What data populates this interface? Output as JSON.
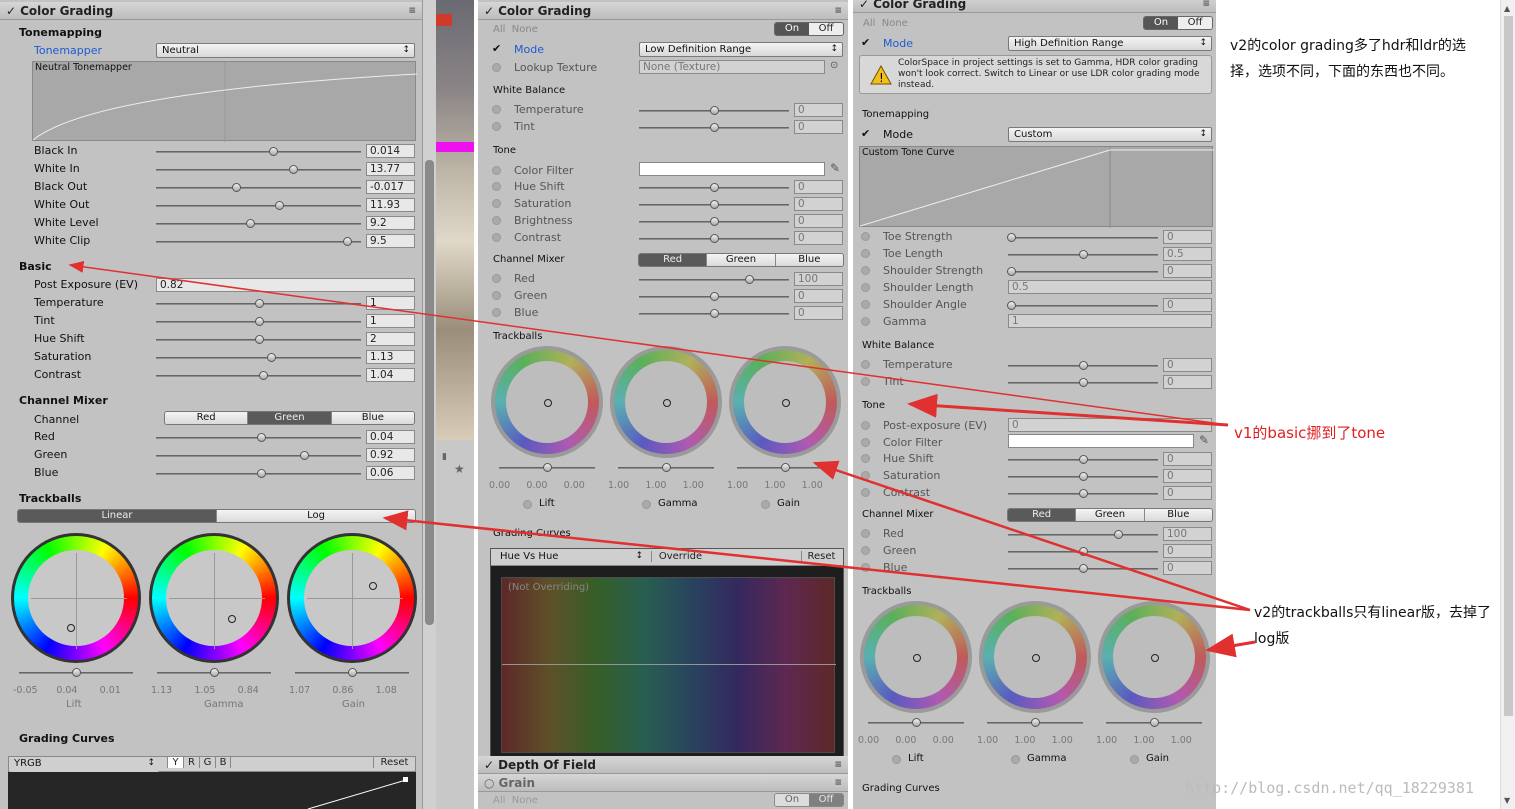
{
  "v1": {
    "header": "Color Grading",
    "tonemapping": "Tonemapping",
    "tonemapper_label": "Tonemapper",
    "tonemapper_value": "Neutral",
    "curve_label": "Neutral Tonemapper",
    "tone_rows": [
      {
        "l": "Black In",
        "v": "0.014"
      },
      {
        "l": "White In",
        "v": "13.77"
      },
      {
        "l": "Black Out",
        "v": "-0.017"
      },
      {
        "l": "White Out",
        "v": "11.93"
      },
      {
        "l": "White Level",
        "v": "9.2"
      },
      {
        "l": "White Clip",
        "v": "9.5"
      }
    ],
    "basic": "Basic",
    "post_label": "Post Exposure (EV)",
    "post_value": "0.82",
    "basic_rows": [
      {
        "l": "Temperature",
        "v": "1"
      },
      {
        "l": "Tint",
        "v": "1"
      },
      {
        "l": "Hue Shift",
        "v": "2"
      },
      {
        "l": "Saturation",
        "v": "1.13"
      },
      {
        "l": "Contrast",
        "v": "1.04"
      }
    ],
    "mixer": "Channel Mixer",
    "channel_label": "Channel",
    "channels": [
      "Red",
      "Green",
      "Blue"
    ],
    "mixer_rows": [
      {
        "l": "Red",
        "v": "0.04"
      },
      {
        "l": "Green",
        "v": "0.92"
      },
      {
        "l": "Blue",
        "v": "0.06"
      }
    ],
    "trackballs": "Trackballs",
    "modes": [
      "Linear",
      "Log"
    ],
    "wheels": [
      {
        "n": "Lift",
        "vals": [
          "-0.05",
          "0.04",
          "0.01"
        ]
      },
      {
        "n": "Gamma",
        "vals": [
          "1.13",
          "1.05",
          "0.84"
        ]
      },
      {
        "n": "Gain",
        "vals": [
          "1.07",
          "0.86",
          "1.08"
        ]
      }
    ],
    "curves": "Grading Curves",
    "curve_sel": "YRGB",
    "curve_btns": [
      "Y",
      "R",
      "G",
      "B"
    ],
    "reset": "Reset"
  },
  "v2a": {
    "header": "Color Grading",
    "all": "All",
    "none": "None",
    "on": "On",
    "off": "Off",
    "mode_label": "Mode",
    "mode_value": "Low Definition Range",
    "lut_label": "Lookup Texture",
    "lut_value": "None (Texture)",
    "wb": "White Balance",
    "wb_rows": [
      {
        "l": "Temperature",
        "v": "0"
      },
      {
        "l": "Tint",
        "v": "0"
      }
    ],
    "tone": "Tone",
    "color_filter": "Color Filter",
    "tone_rows": [
      {
        "l": "Hue Shift",
        "v": "0"
      },
      {
        "l": "Saturation",
        "v": "0"
      },
      {
        "l": "Brightness",
        "v": "0"
      },
      {
        "l": "Contrast",
        "v": "0"
      }
    ],
    "mixer": "Channel Mixer",
    "channels": [
      "Red",
      "Green",
      "Blue"
    ],
    "mixer_rows": [
      {
        "l": "Red",
        "v": "100"
      },
      {
        "l": "Green",
        "v": "0"
      },
      {
        "l": "Blue",
        "v": "0"
      }
    ],
    "trackballs": "Trackballs",
    "wheels": [
      {
        "n": "Lift",
        "vals": [
          "0.00",
          "0.00",
          "0.00"
        ]
      },
      {
        "n": "Gamma",
        "vals": [
          "1.00",
          "1.00",
          "1.00"
        ]
      },
      {
        "n": "Gain",
        "vals": [
          "1.00",
          "1.00",
          "1.00"
        ]
      }
    ],
    "curves": "Grading Curves",
    "curve_sel": "Hue Vs Hue",
    "override": "Override",
    "reset": "Reset",
    "not_overriding": "(Not Overriding)",
    "dof": "Depth Of Field",
    "grain": "Grain"
  },
  "v2b": {
    "header": "Color Grading",
    "all": "All",
    "none": "None",
    "on": "On",
    "off": "Off",
    "mode_label": "Mode",
    "mode_value": "High Definition Range",
    "warning": "ColorSpace in project settings is set to Gamma, HDR color grading won't look correct. Switch to Linear or use LDR color grading mode instead.",
    "tonemapping": "Tonemapping",
    "tm_mode_label": "Mode",
    "tm_mode_value": "Custom",
    "curve_label": "Custom Tone Curve",
    "tm_rows": [
      {
        "l": "Toe Strength",
        "v": "0"
      },
      {
        "l": "Toe Length",
        "v": "0.5"
      },
      {
        "l": "Shoulder Strength",
        "v": "0"
      },
      {
        "l": "Shoulder Length",
        "v": "0.5"
      },
      {
        "l": "Shoulder Angle",
        "v": "0"
      },
      {
        "l": "Gamma",
        "v": "1"
      }
    ],
    "wb": "White Balance",
    "wb_rows": [
      {
        "l": "Temperature",
        "v": "0"
      },
      {
        "l": "Tint",
        "v": "0"
      }
    ],
    "tone": "Tone",
    "post_label": "Post-exposure (EV)",
    "post_value": "0",
    "color_filter": "Color Filter",
    "tone_rows": [
      {
        "l": "Hue Shift",
        "v": "0"
      },
      {
        "l": "Saturation",
        "v": "0"
      },
      {
        "l": "Contrast",
        "v": "0"
      }
    ],
    "mixer": "Channel Mixer",
    "channels": [
      "Red",
      "Green",
      "Blue"
    ],
    "mixer_rows": [
      {
        "l": "Red",
        "v": "100"
      },
      {
        "l": "Green",
        "v": "0"
      },
      {
        "l": "Blue",
        "v": "0"
      }
    ],
    "trackballs": "Trackballs",
    "wheels": [
      {
        "n": "Lift",
        "vals": [
          "0.00",
          "0.00",
          "0.00"
        ]
      },
      {
        "n": "Gamma",
        "vals": [
          "1.00",
          "1.00",
          "1.00"
        ]
      },
      {
        "n": "Gain",
        "vals": [
          "1.00",
          "1.00",
          "1.00"
        ]
      }
    ],
    "curves": "Grading Curves"
  },
  "notes": {
    "n1": "v2的color grading多了hdr和ldr的选择，选项不同，下面的东西也不同。",
    "n2": "v1的basic挪到了tone",
    "n3": "v2的trackballs只有linear版，去掉了log版",
    "watermark": "http://blog.csdn.net/qq_18229381"
  },
  "colors": {
    "panel": "#c2c2c2",
    "accent": "#3a6fd8",
    "arrow": "#e03030"
  }
}
